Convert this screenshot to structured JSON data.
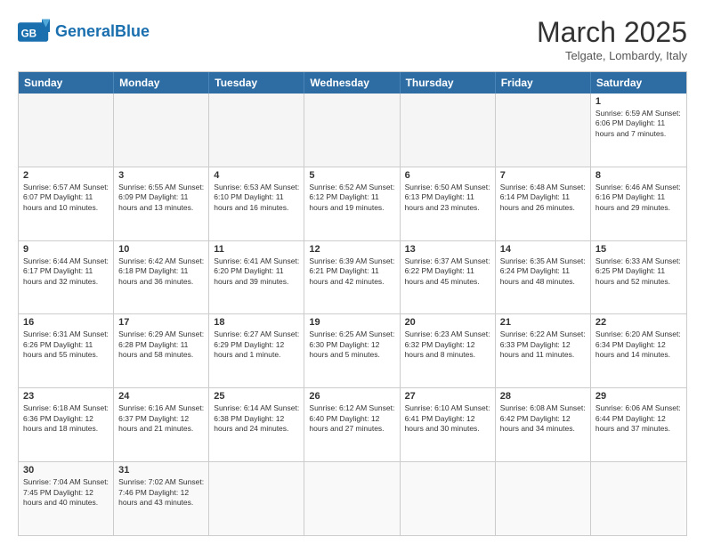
{
  "header": {
    "logo_general": "General",
    "logo_blue": "Blue",
    "month_title": "March 2025",
    "subtitle": "Telgate, Lombardy, Italy"
  },
  "days_of_week": [
    "Sunday",
    "Monday",
    "Tuesday",
    "Wednesday",
    "Thursday",
    "Friday",
    "Saturday"
  ],
  "weeks": [
    [
      {
        "day": "",
        "info": "",
        "empty": true
      },
      {
        "day": "",
        "info": "",
        "empty": true
      },
      {
        "day": "",
        "info": "",
        "empty": true
      },
      {
        "day": "",
        "info": "",
        "empty": true
      },
      {
        "day": "",
        "info": "",
        "empty": true
      },
      {
        "day": "",
        "info": "",
        "empty": true
      },
      {
        "day": "1",
        "info": "Sunrise: 6:59 AM\nSunset: 6:06 PM\nDaylight: 11 hours\nand 7 minutes.",
        "empty": false
      }
    ],
    [
      {
        "day": "2",
        "info": "Sunrise: 6:57 AM\nSunset: 6:07 PM\nDaylight: 11 hours\nand 10 minutes.",
        "empty": false
      },
      {
        "day": "3",
        "info": "Sunrise: 6:55 AM\nSunset: 6:09 PM\nDaylight: 11 hours\nand 13 minutes.",
        "empty": false
      },
      {
        "day": "4",
        "info": "Sunrise: 6:53 AM\nSunset: 6:10 PM\nDaylight: 11 hours\nand 16 minutes.",
        "empty": false
      },
      {
        "day": "5",
        "info": "Sunrise: 6:52 AM\nSunset: 6:12 PM\nDaylight: 11 hours\nand 19 minutes.",
        "empty": false
      },
      {
        "day": "6",
        "info": "Sunrise: 6:50 AM\nSunset: 6:13 PM\nDaylight: 11 hours\nand 23 minutes.",
        "empty": false
      },
      {
        "day": "7",
        "info": "Sunrise: 6:48 AM\nSunset: 6:14 PM\nDaylight: 11 hours\nand 26 minutes.",
        "empty": false
      },
      {
        "day": "8",
        "info": "Sunrise: 6:46 AM\nSunset: 6:16 PM\nDaylight: 11 hours\nand 29 minutes.",
        "empty": false
      }
    ],
    [
      {
        "day": "9",
        "info": "Sunrise: 6:44 AM\nSunset: 6:17 PM\nDaylight: 11 hours\nand 32 minutes.",
        "empty": false
      },
      {
        "day": "10",
        "info": "Sunrise: 6:42 AM\nSunset: 6:18 PM\nDaylight: 11 hours\nand 36 minutes.",
        "empty": false
      },
      {
        "day": "11",
        "info": "Sunrise: 6:41 AM\nSunset: 6:20 PM\nDaylight: 11 hours\nand 39 minutes.",
        "empty": false
      },
      {
        "day": "12",
        "info": "Sunrise: 6:39 AM\nSunset: 6:21 PM\nDaylight: 11 hours\nand 42 minutes.",
        "empty": false
      },
      {
        "day": "13",
        "info": "Sunrise: 6:37 AM\nSunset: 6:22 PM\nDaylight: 11 hours\nand 45 minutes.",
        "empty": false
      },
      {
        "day": "14",
        "info": "Sunrise: 6:35 AM\nSunset: 6:24 PM\nDaylight: 11 hours\nand 48 minutes.",
        "empty": false
      },
      {
        "day": "15",
        "info": "Sunrise: 6:33 AM\nSunset: 6:25 PM\nDaylight: 11 hours\nand 52 minutes.",
        "empty": false
      }
    ],
    [
      {
        "day": "16",
        "info": "Sunrise: 6:31 AM\nSunset: 6:26 PM\nDaylight: 11 hours\nand 55 minutes.",
        "empty": false
      },
      {
        "day": "17",
        "info": "Sunrise: 6:29 AM\nSunset: 6:28 PM\nDaylight: 11 hours\nand 58 minutes.",
        "empty": false
      },
      {
        "day": "18",
        "info": "Sunrise: 6:27 AM\nSunset: 6:29 PM\nDaylight: 12 hours\nand 1 minute.",
        "empty": false
      },
      {
        "day": "19",
        "info": "Sunrise: 6:25 AM\nSunset: 6:30 PM\nDaylight: 12 hours\nand 5 minutes.",
        "empty": false
      },
      {
        "day": "20",
        "info": "Sunrise: 6:23 AM\nSunset: 6:32 PM\nDaylight: 12 hours\nand 8 minutes.",
        "empty": false
      },
      {
        "day": "21",
        "info": "Sunrise: 6:22 AM\nSunset: 6:33 PM\nDaylight: 12 hours\nand 11 minutes.",
        "empty": false
      },
      {
        "day": "22",
        "info": "Sunrise: 6:20 AM\nSunset: 6:34 PM\nDaylight: 12 hours\nand 14 minutes.",
        "empty": false
      }
    ],
    [
      {
        "day": "23",
        "info": "Sunrise: 6:18 AM\nSunset: 6:36 PM\nDaylight: 12 hours\nand 18 minutes.",
        "empty": false
      },
      {
        "day": "24",
        "info": "Sunrise: 6:16 AM\nSunset: 6:37 PM\nDaylight: 12 hours\nand 21 minutes.",
        "empty": false
      },
      {
        "day": "25",
        "info": "Sunrise: 6:14 AM\nSunset: 6:38 PM\nDaylight: 12 hours\nand 24 minutes.",
        "empty": false
      },
      {
        "day": "26",
        "info": "Sunrise: 6:12 AM\nSunset: 6:40 PM\nDaylight: 12 hours\nand 27 minutes.",
        "empty": false
      },
      {
        "day": "27",
        "info": "Sunrise: 6:10 AM\nSunset: 6:41 PM\nDaylight: 12 hours\nand 30 minutes.",
        "empty": false
      },
      {
        "day": "28",
        "info": "Sunrise: 6:08 AM\nSunset: 6:42 PM\nDaylight: 12 hours\nand 34 minutes.",
        "empty": false
      },
      {
        "day": "29",
        "info": "Sunrise: 6:06 AM\nSunset: 6:44 PM\nDaylight: 12 hours\nand 37 minutes.",
        "empty": false
      }
    ],
    [
      {
        "day": "30",
        "info": "Sunrise: 7:04 AM\nSunset: 7:45 PM\nDaylight: 12 hours\nand 40 minutes.",
        "empty": false
      },
      {
        "day": "31",
        "info": "Sunrise: 7:02 AM\nSunset: 7:46 PM\nDaylight: 12 hours\nand 43 minutes.",
        "empty": false
      },
      {
        "day": "",
        "info": "",
        "empty": true
      },
      {
        "day": "",
        "info": "",
        "empty": true
      },
      {
        "day": "",
        "info": "",
        "empty": true
      },
      {
        "day": "",
        "info": "",
        "empty": true
      },
      {
        "day": "",
        "info": "",
        "empty": true
      }
    ]
  ]
}
